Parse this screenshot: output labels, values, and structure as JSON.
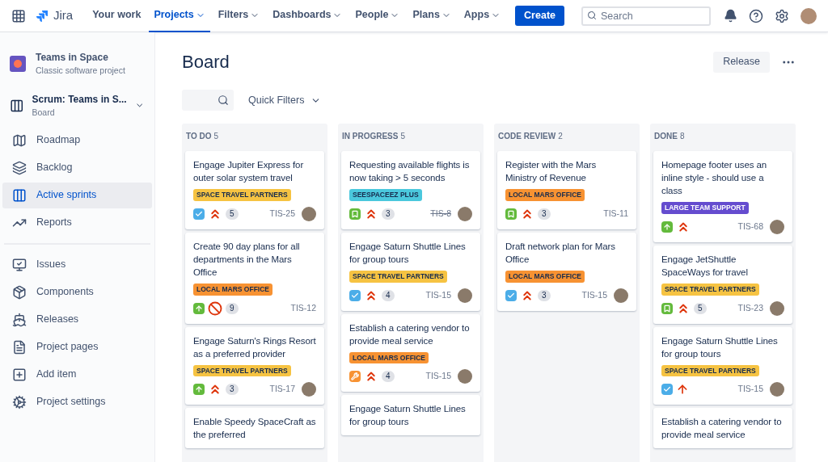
{
  "nav": {
    "product": "Jira",
    "items": [
      {
        "label": "Your work",
        "selected": false,
        "dropdown": false
      },
      {
        "label": "Projects",
        "selected": true,
        "dropdown": true
      },
      {
        "label": "Filters",
        "selected": false,
        "dropdown": true
      },
      {
        "label": "Dashboards",
        "selected": false,
        "dropdown": true
      },
      {
        "label": "People",
        "selected": false,
        "dropdown": true
      },
      {
        "label": "Plans",
        "selected": false,
        "dropdown": true
      },
      {
        "label": "Apps",
        "selected": false,
        "dropdown": true
      }
    ],
    "create": "Create",
    "search": {
      "placeholder": "Search"
    }
  },
  "sidebar": {
    "project": {
      "name": "Teams in Space",
      "type": "Classic software project"
    },
    "board": {
      "name": "Scrum: Teams in S...",
      "type": "Board"
    },
    "items": [
      {
        "label": "Roadmap",
        "selected": false
      },
      {
        "label": "Backlog",
        "selected": false
      },
      {
        "label": "Active sprints",
        "selected": true
      },
      {
        "label": "Reports",
        "selected": false
      }
    ],
    "items_2": [
      {
        "label": "Issues",
        "selected": false
      },
      {
        "label": "Components",
        "selected": false
      },
      {
        "label": "Releases",
        "selected": false
      },
      {
        "label": "Project pages",
        "selected": false
      },
      {
        "label": "Add item",
        "selected": false
      },
      {
        "label": "Project settings",
        "selected": false
      }
    ]
  },
  "board": {
    "title": "Board",
    "release": "Release",
    "quick_filters": "Quick Filters",
    "columns": [
      {
        "name": "TO DO",
        "count": "5",
        "cards": [
          {
            "title": "Engage Jupiter Express for outer solar system travel",
            "label": "SPACE TRAVEL PARTNERS",
            "color": "#f6c342",
            "kind": "task",
            "priority": {
              "kind": "highest"
            },
            "points": "5",
            "key": "TIS-25",
            "resolved": false,
            "avatar": true
          },
          {
            "title": "Create 90 day plans for all departments in the Mars Office",
            "label": "LOCAL MARS OFFICE",
            "color": "#f79232",
            "kind": "improvement",
            "priority": {
              "kind": "blocker"
            },
            "points": "9",
            "key": "TIS-12",
            "resolved": false,
            "avatar": false
          },
          {
            "title": "Engage Saturn's Rings Resort as a preferred provider",
            "label": "SPACE TRAVEL PARTNERS",
            "color": "#f6c342",
            "kind": "improvement",
            "priority": {
              "kind": "highest"
            },
            "points": "3",
            "key": "TIS-17",
            "resolved": false,
            "avatar": true
          },
          {
            "title": "Enable Speedy SpaceCraft as the preferred"
          }
        ]
      },
      {
        "name": "IN PROGRESS",
        "count": "5",
        "cards": [
          {
            "title": "Requesting available flights is now taking > 5 seconds",
            "label": "SEESPACEEZ PLUS",
            "color": "#4bc8dd",
            "kind": "story",
            "priority": {
              "kind": "highest"
            },
            "points": "3",
            "key": "TIS-8",
            "resolved": true,
            "avatar": true
          },
          {
            "title": "Engage Saturn Shuttle Lines for group tours",
            "label": "SPACE TRAVEL PARTNERS",
            "color": "#f6c342",
            "kind": "task",
            "priority": {
              "kind": "highest"
            },
            "points": "4",
            "key": "TIS-15",
            "resolved": false,
            "avatar": true
          },
          {
            "title": "Establish a catering vendor to provide meal service",
            "label": "LOCAL MARS OFFICE",
            "color": "#f79232",
            "kind": "subtask",
            "priority": {
              "kind": "highest"
            },
            "points": "4",
            "key": "TIS-15",
            "resolved": false,
            "avatar": true
          },
          {
            "title": "Engage Saturn Shuttle Lines for group tours"
          }
        ]
      },
      {
        "name": "CODE REVIEW",
        "count": "2",
        "cards": [
          {
            "title": "Register with the Mars Ministry of Revenue",
            "label": "LOCAL MARS OFFICE",
            "color": "#f79232",
            "kind": "story",
            "priority": {
              "kind": "highest"
            },
            "points": "3",
            "key": "TIS-11",
            "resolved": false,
            "avatar": false
          },
          {
            "title": "Draft network plan for Mars Office",
            "label": "LOCAL MARS OFFICE",
            "color": "#f79232",
            "kind": "task",
            "priority": {
              "kind": "highest"
            },
            "points": "3",
            "key": "TIS-15",
            "resolved": false,
            "avatar": true
          }
        ]
      },
      {
        "name": "DONE",
        "count": "8",
        "cards": [
          {
            "title": "Homepage footer uses an inline style - should use a class",
            "label": "LARGE TEAM SUPPORT",
            "color": "#654ccf",
            "kind": "improvement",
            "priority": {
              "kind": "highest"
            },
            "key": "TIS-68",
            "resolved": false,
            "avatar": true
          },
          {
            "title": "Engage JetShuttle SpaceWays for travel",
            "label": "SPACE TRAVEL PARTNERS",
            "color": "#f6c342",
            "kind": "story",
            "priority": {
              "kind": "highest"
            },
            "points": "5",
            "key": "TIS-23",
            "resolved": false,
            "avatar": true
          },
          {
            "title": "Engage Saturn Shuttle Lines for group tours",
            "label": "SPACE TRAVEL PARTNERS",
            "color": "#f6c342",
            "kind": "task",
            "priority": {
              "kind": "high"
            },
            "key": "TIS-15",
            "resolved": false,
            "avatar": true
          },
          {
            "title": "Establish a catering vendor to provide meal service"
          }
        ]
      }
    ]
  }
}
